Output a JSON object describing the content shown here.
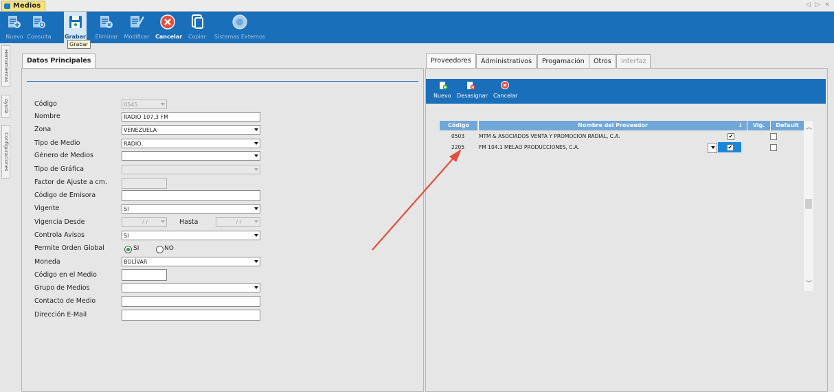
{
  "window": {
    "tab_title": "Medios",
    "nav_arrows": "◁ ▷ ×"
  },
  "toolbar": {
    "nuevo": "Nuevo",
    "consulta": "Consulta",
    "grabar": "Grabar",
    "eliminar": "Eliminar",
    "modificar": "Modificar",
    "cancelar": "Cancelar",
    "copiar": "Copiar",
    "sistemas": "Sistemas Externos",
    "tooltip": "Grabar"
  },
  "side_tabs": {
    "herramientas": "Herramientas",
    "ayuda": "Ayuda",
    "configuraciones": "Configuraciones"
  },
  "left_panel": {
    "tab": "Datos Principales",
    "labels": {
      "codigo": "Código",
      "nombre": "Nombre",
      "zona": "Zona",
      "tipo_medio": "Tipo de Medio",
      "genero": "Género de Medios",
      "tipo_grafica": "Tipo de Gráfica",
      "factor": "Factor de Ajuste a cm.",
      "codigo_emisora": "Código de Emisora",
      "vigente": "Vigente",
      "vigencia_desde": "Vigencia Desde",
      "hasta": "Hasta",
      "controla_avisos": "Controla Avisos",
      "permite_orden": "Permite Orden Global",
      "moneda": "Moneda",
      "codigo_medio": "Código en el Medio",
      "grupo": "Grupo de Medios",
      "contacto": "Contacto de Medio",
      "email": "Dirección E-Mail"
    },
    "values": {
      "codigo": "0545",
      "nombre": "RADIO 107,3 FM",
      "zona": "VENEZUELA",
      "tipo_medio": "RADIO",
      "vigente": "SI",
      "fecha_desde": "/ /",
      "fecha_hasta": "/ /",
      "controla_avisos": "SI",
      "radio_si": "SI",
      "radio_no": "NO",
      "moneda": "BOLÍVAR"
    }
  },
  "right_panel": {
    "tabs": [
      "Proveedores",
      "Administrativos",
      "Progamación",
      "Otros",
      "Interfaz"
    ],
    "toolbar": {
      "nuevo": "Nuevo",
      "desasignar": "Desasignar",
      "cancelar": "Cancelar"
    },
    "grid": {
      "headers": {
        "codigo": "Código",
        "nombre": "Nombre del Proveedor",
        "vig": "Vig.",
        "default": "Default"
      },
      "rows": [
        {
          "codigo": "0503",
          "nombre": "MTM & ASOCIADOS VENTA Y PROMOCION RADIAL, C.A.",
          "vig": "✔",
          "default": ""
        },
        {
          "codigo": "2205",
          "nombre": "FM 104.1 MELAO PRODUCCIONES, C.A.",
          "vig": "✔",
          "default": ""
        }
      ]
    }
  },
  "colors": {
    "toolbar": "#1a6fba",
    "grid_header": "#6fa7d8",
    "arrow": "#e0503c"
  }
}
